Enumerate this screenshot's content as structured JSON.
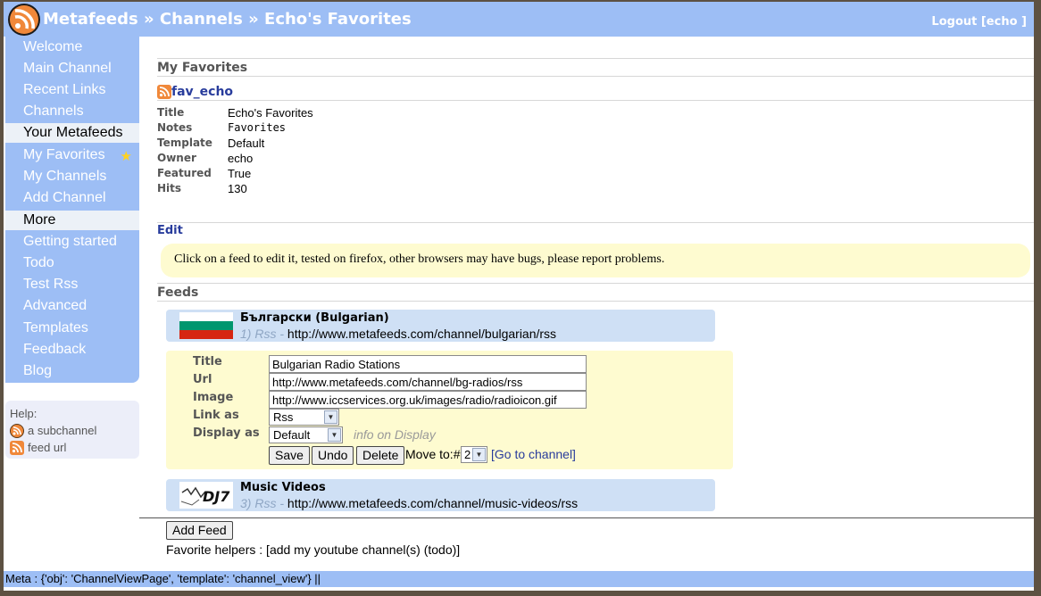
{
  "header": {
    "crumb_root": "Metafeeds",
    "sep1": "»",
    "crumb_channels": "Channels",
    "sep2": "»",
    "crumb_current": "Echo's Favorites",
    "logout": "Logout [echo ]"
  },
  "sidebar": {
    "items": [
      {
        "label": "Welcome"
      },
      {
        "label": "Main Channel"
      },
      {
        "label": "Recent Links"
      },
      {
        "label": "Channels"
      },
      {
        "label": "Your Metafeeds",
        "section": true
      },
      {
        "label": "My Favorites"
      },
      {
        "label": "My Channels"
      },
      {
        "label": "Add Channel"
      },
      {
        "label": "More",
        "section": true
      },
      {
        "label": "Getting started"
      },
      {
        "label": "Todo"
      },
      {
        "label": "Test Rss"
      },
      {
        "label": "Advanced"
      },
      {
        "label": "Templates"
      },
      {
        "label": "Feedback"
      },
      {
        "label": "Blog"
      }
    ],
    "help": {
      "title": "Help:",
      "subchannel": "a subchannel",
      "feed_url": "feed url"
    }
  },
  "main": {
    "section_title": "My Favorites",
    "fav_name": "fav_echo",
    "props": [
      {
        "key": "Title",
        "value": "Echo's Favorites"
      },
      {
        "key": "Notes",
        "value": "Favorites"
      },
      {
        "key": "Template",
        "value": "Default"
      },
      {
        "key": "Owner",
        "value": "echo"
      },
      {
        "key": "Featured",
        "value": "True"
      },
      {
        "key": "Hits",
        "value": "130"
      }
    ],
    "edit_label": "Edit",
    "notice": "Click on a feed to edit it, tested on firefox, other browsers may have bugs, please report problems.",
    "feeds_title": "Feeds",
    "feeds": [
      {
        "title": "Български (Bulgarian)",
        "index": "1) Rss",
        "url": "http://www.metafeeds.com/channel/bulgarian/rss"
      },
      {
        "title": "Music Videos",
        "index": "3) Rss",
        "url": "http://www.metafeeds.com/channel/music-videos/rss"
      }
    ],
    "editor": {
      "title_label": "Title",
      "title_value": "Bulgarian Radio Stations",
      "url_label": "Url",
      "url_value": "http://www.metafeeds.com/channel/bg-radios/rss",
      "image_label": "Image",
      "image_value": "http://www.iccservices.org.uk/images/radio/radioicon.gif",
      "link_as_label": "Link as",
      "link_as_value": "Rss",
      "display_as_label": "Display as",
      "display_as_value": "Default",
      "display_hint": "info on Display",
      "save": "Save",
      "undo": "Undo",
      "delete": "Delete",
      "move_to": "Move to:#",
      "move_value": "2",
      "go_to_channel": "[Go to channel]"
    },
    "add_feed": "Add Feed",
    "helpers": "Favorite helpers : [add my youtube channel(s) (todo)]"
  },
  "footer": {
    "meta": "Meta : {'obj': 'ChannelViewPage', 'template': 'channel_view'} ||"
  },
  "colors": {
    "header_bg": "#9dbef5",
    "link": "#283c9c",
    "notice_bg": "#fefbd0",
    "card_bg": "#cfe0f5",
    "rss_orange": "#f0883a"
  }
}
